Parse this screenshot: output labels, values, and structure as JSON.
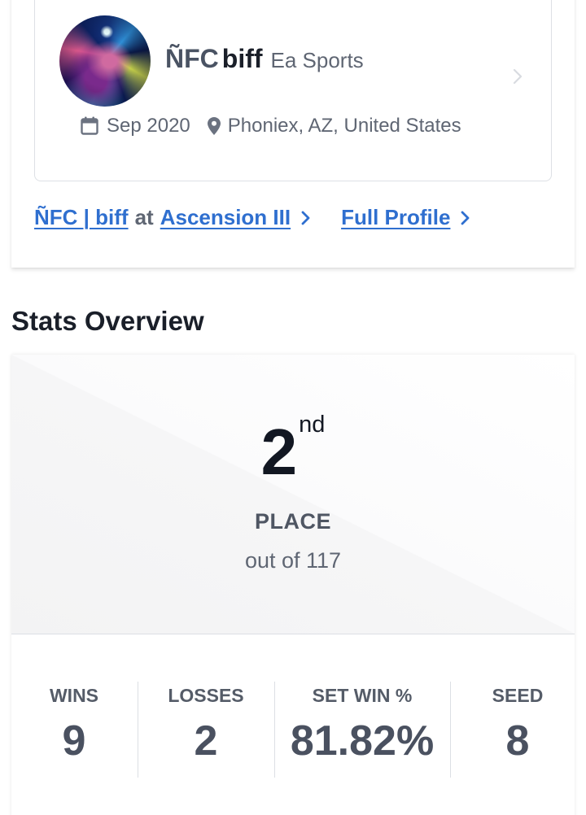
{
  "profile": {
    "tag": "ÑFC",
    "gamertag": "biff",
    "org": "Ea Sports",
    "date": "Sep 2020",
    "location": "Phoniex, AZ, United States"
  },
  "links": {
    "entrant_name": "ÑFC | biff",
    "at": "at",
    "event_name": "Ascension III",
    "full_profile": "Full Profile"
  },
  "stats_overview": {
    "title": "Stats Overview",
    "place_number": "2",
    "place_suffix": "nd",
    "place_label": "PLACE",
    "out_of": "out of 117",
    "items": [
      {
        "label": "WINS",
        "value": "9"
      },
      {
        "label": "LOSSES",
        "value": "2"
      },
      {
        "label": "SET WIN %",
        "value": "81.82%"
      },
      {
        "label": "SEED",
        "value": "8"
      }
    ]
  },
  "colors": {
    "link": "#2f6fcf",
    "text_dark": "#1a1f29",
    "text_muted": "#5f6673"
  },
  "icons": [
    "calendar-icon",
    "location-pin-icon",
    "chevron-right-icon"
  ]
}
